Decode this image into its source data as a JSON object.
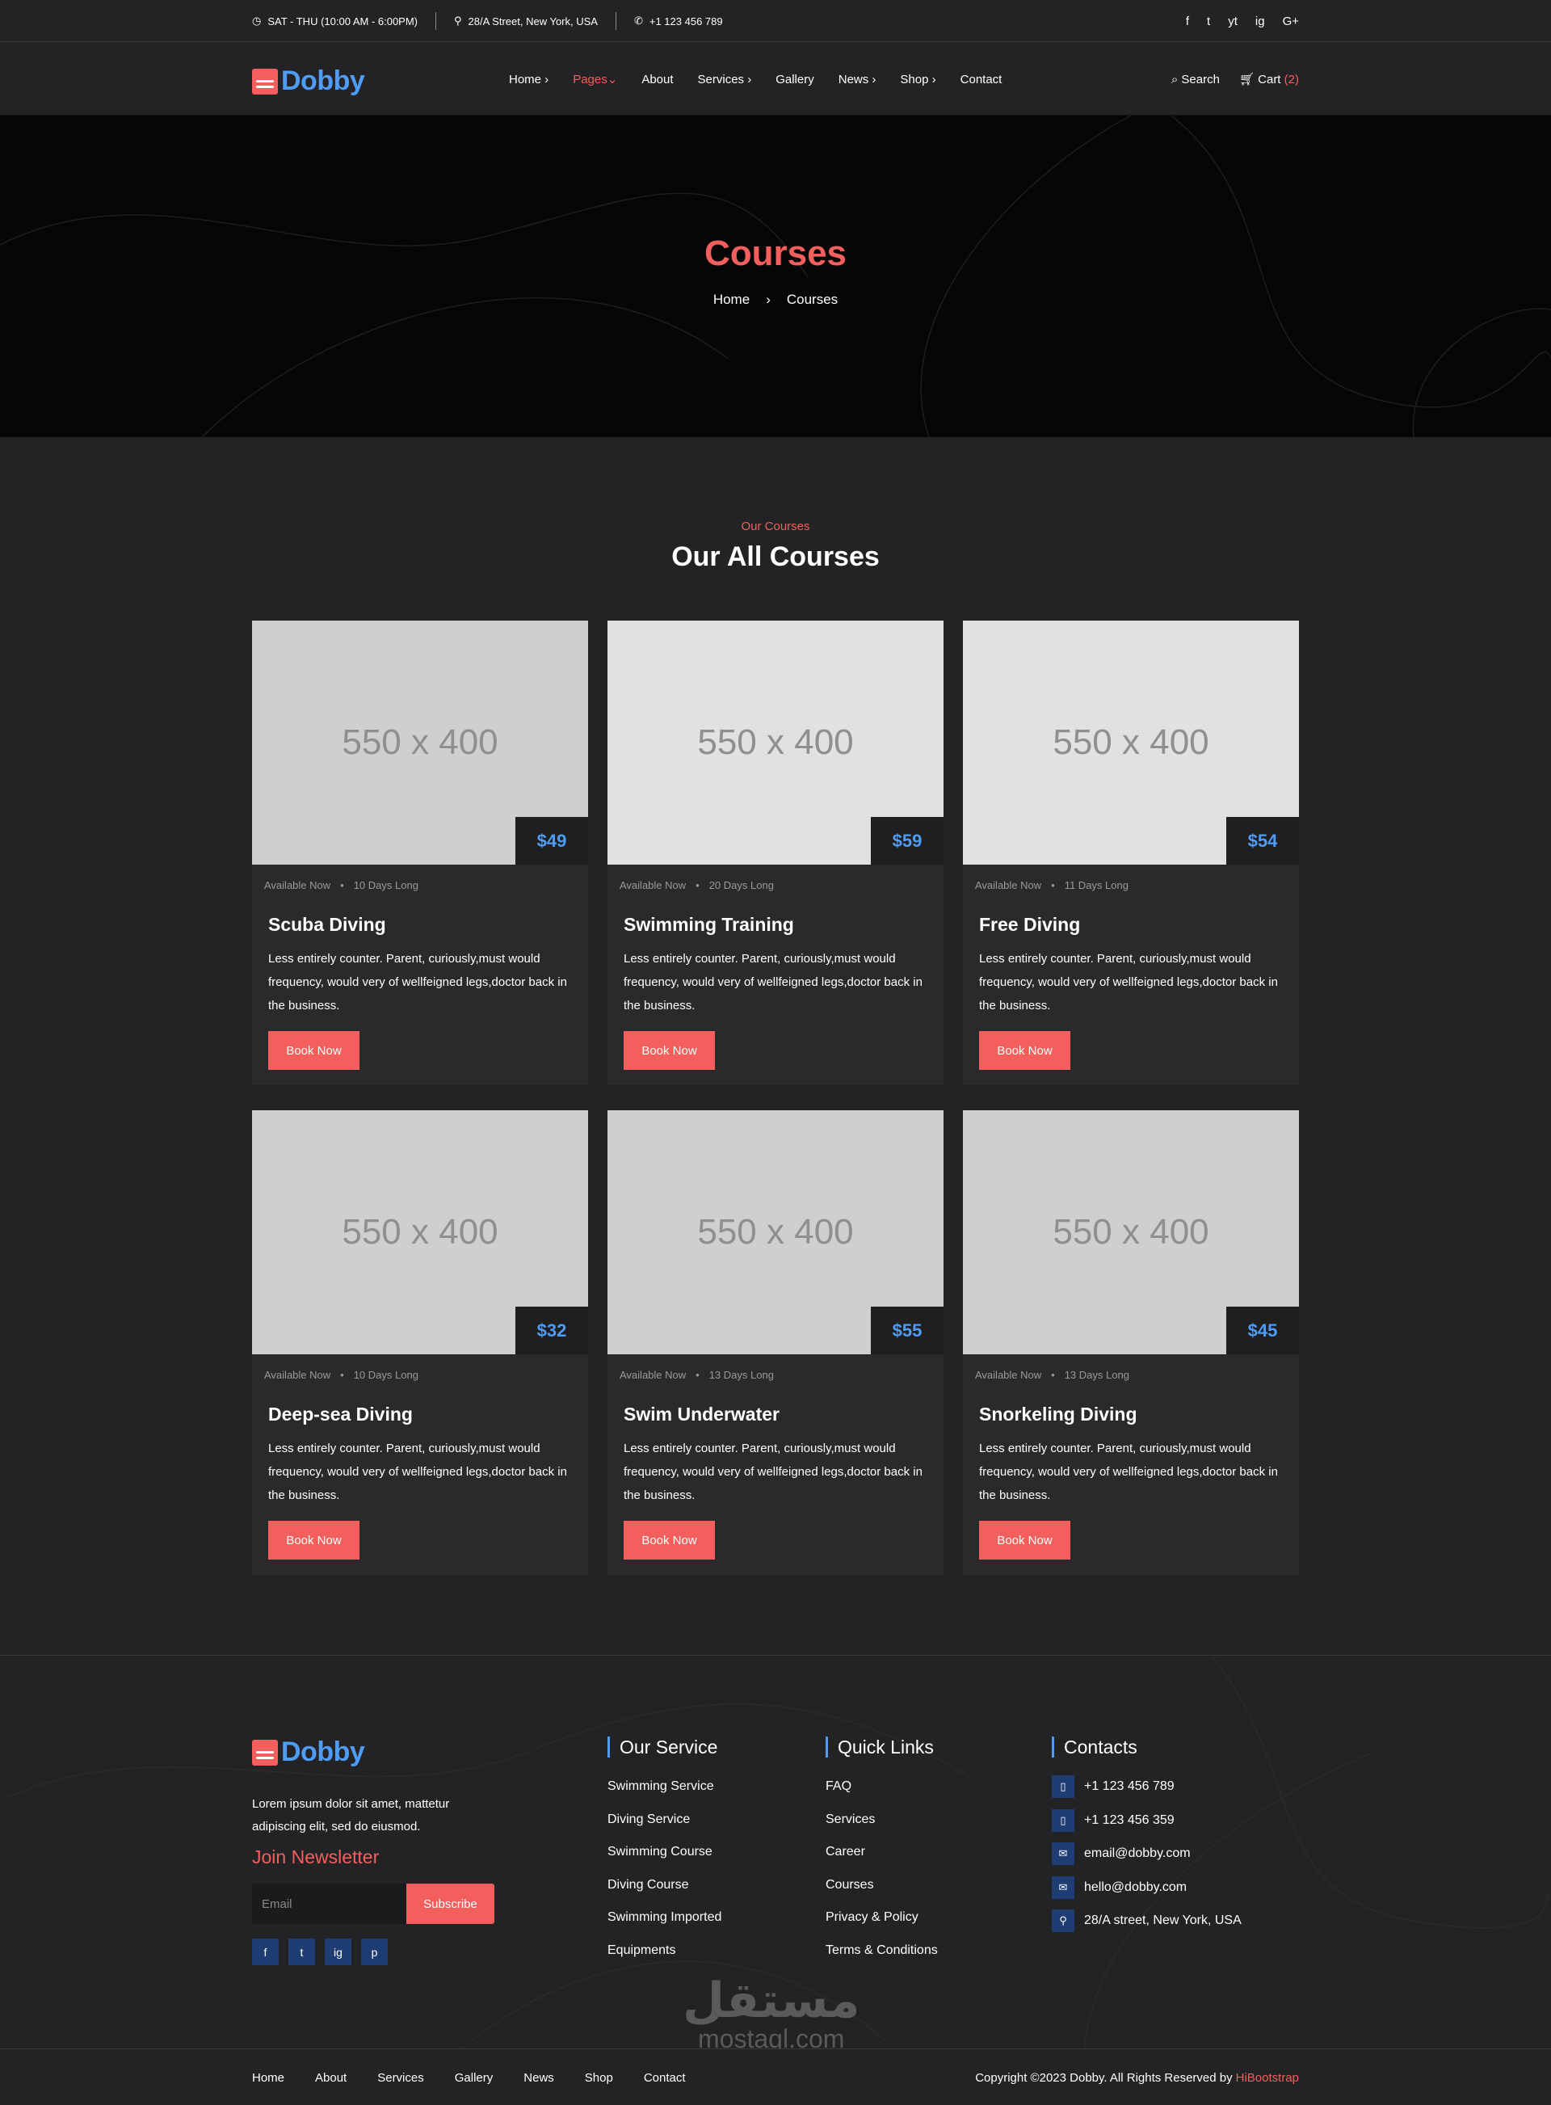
{
  "topbar": {
    "hours": "SAT - THU (10:00 AM - 6:00PM)",
    "address": "28/A Street, New York, USA",
    "phone": "+1 123 456 789",
    "social": [
      "f",
      "t",
      "yt",
      "ig",
      "G+"
    ]
  },
  "brand": {
    "name": "Dobby"
  },
  "nav": {
    "items": [
      "Home",
      "Pages",
      "About",
      "Services",
      "Gallery",
      "News",
      "Shop",
      "Contact"
    ],
    "search_label": "Search",
    "cart_label": "Cart",
    "cart_count": "(2)"
  },
  "banner": {
    "title": "Courses",
    "breadcrumb": [
      "Home",
      "Courses"
    ]
  },
  "section": {
    "subtitle": "Our Courses",
    "title": "Our All Courses"
  },
  "courses": [
    {
      "image": "550 x 400",
      "price": "$49",
      "availability": "Available Now",
      "duration": "10 Days Long",
      "title": "Scuba Diving",
      "desc": "Less entirely counter. Parent, curiously,must would frequency, would very of wellfeigned legs,doctor back in the business.",
      "button": "Book Now"
    },
    {
      "image": "550 x 400",
      "price": "$59",
      "availability": "Available Now",
      "duration": "20 Days Long",
      "title": "Swimming Training",
      "desc": "Less entirely counter. Parent, curiously,must would frequency, would very of wellfeigned legs,doctor back in the business.",
      "button": "Book Now"
    },
    {
      "image": "550 x 400",
      "price": "$54",
      "availability": "Available Now",
      "duration": "11 Days Long",
      "title": "Free Diving",
      "desc": "Less entirely counter. Parent, curiously,must would frequency, would very of wellfeigned legs,doctor back in the business.",
      "button": "Book Now"
    },
    {
      "image": "550 x 400",
      "price": "$32",
      "availability": "Available Now",
      "duration": "10 Days Long",
      "title": "Deep-sea Diving",
      "desc": "Less entirely counter. Parent, curiously,must would frequency, would very of wellfeigned legs,doctor back in the business.",
      "button": "Book Now"
    },
    {
      "image": "550 x 400",
      "price": "$55",
      "availability": "Available Now",
      "duration": "13 Days Long",
      "title": "Swim Underwater",
      "desc": "Less entirely counter. Parent, curiously,must would frequency, would very of wellfeigned legs,doctor back in the business.",
      "button": "Book Now"
    },
    {
      "image": "550 x 400",
      "price": "$45",
      "availability": "Available Now",
      "duration": "13 Days Long",
      "title": "Snorkeling Diving",
      "desc": "Less entirely counter. Parent, curiously,must would frequency, would very of wellfeigned legs,doctor back in the business.",
      "button": "Book Now"
    }
  ],
  "footer": {
    "about": "Lorem ipsum dolor sit amet, mattetur adipiscing elit, sed do eiusmod.",
    "newsletter_title": "Join Newsletter",
    "email_placeholder": "Email",
    "subscribe_label": "Subscribe",
    "social": [
      "f",
      "t",
      "ig",
      "p"
    ],
    "service": {
      "title": "Our Service",
      "items": [
        "Swimming Service",
        "Diving Service",
        "Swimming Course",
        "Diving Course",
        "Swimming Imported",
        "Equipments"
      ]
    },
    "quick": {
      "title": "Quick Links",
      "items": [
        "FAQ",
        "Services",
        "Career",
        "Courses",
        "Privacy & Policy",
        "Terms & Conditions"
      ]
    },
    "contacts": {
      "title": "Contacts",
      "items": [
        "+1 123 456 789",
        "+1 123 456 359",
        "email@dobby.com",
        "hello@dobby.com",
        "28/A street, New York, USA"
      ]
    },
    "bottom_links": [
      "Home",
      "About",
      "Services",
      "Gallery",
      "News",
      "Shop",
      "Contact"
    ],
    "copyright": "Copyright ©2023 Dobby. All Rights Reserved by",
    "copyright_brand": "HiBootstrap"
  },
  "watermark": {
    "arabic": "مستقل",
    "latin": "mostaql.com"
  },
  "colors": {
    "accent": "#f25f5c",
    "brand_blue": "#4e9cf5",
    "bg": "#232325",
    "card": "#2a2a2d"
  }
}
